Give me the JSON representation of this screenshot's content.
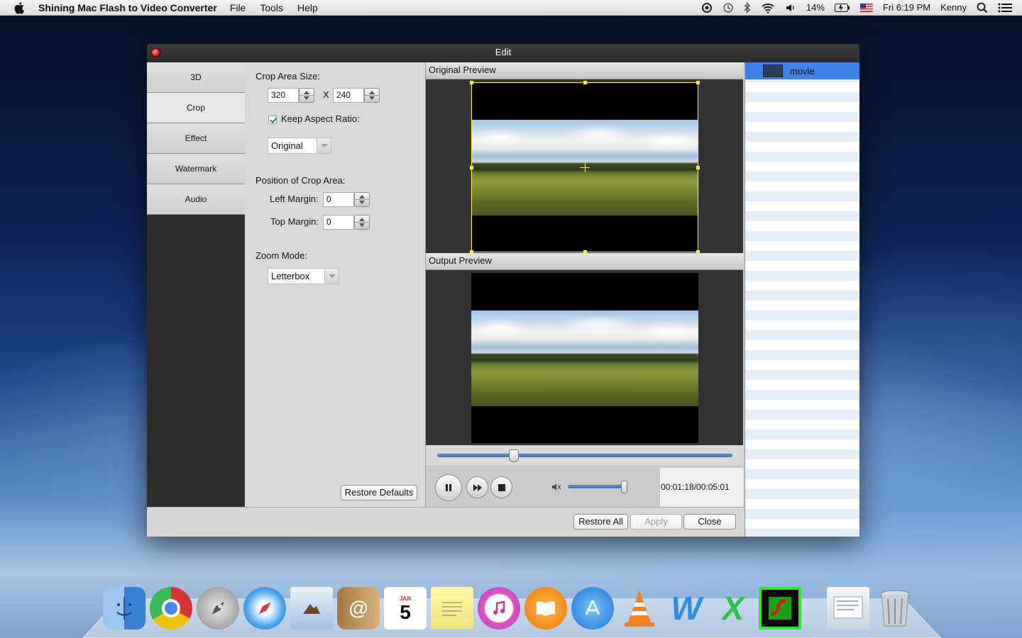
{
  "menubar": {
    "app_name": "Shining Mac Flash to Video Converter",
    "menus": [
      "File",
      "Tools",
      "Help"
    ],
    "battery": "14%",
    "datetime": "Fri 6:19 PM",
    "user": "Kenny"
  },
  "window": {
    "title": "Edit",
    "tabs": [
      {
        "label": "3D",
        "active": false
      },
      {
        "label": "Crop",
        "active": true
      },
      {
        "label": "Effect",
        "active": false
      },
      {
        "label": "Watermark",
        "active": false
      },
      {
        "label": "Audio",
        "active": false
      }
    ],
    "crop": {
      "size_label": "Crop Area Size:",
      "width": "320",
      "x_sep": "X",
      "height": "240",
      "keep_aspect_label": "Keep Aspect Ratio:",
      "keep_aspect_checked": true,
      "aspect_value": "Original",
      "position_label": "Position of Crop Area:",
      "left_margin_label": "Left Margin:",
      "left_margin": "0",
      "top_margin_label": "Top Margin:",
      "top_margin": "0",
      "zoom_label": "Zoom Mode:",
      "zoom_value": "Letterbox",
      "restore_defaults": "Restore Defaults"
    },
    "preview": {
      "original_label": "Original Preview",
      "output_label": "Output Preview",
      "seek_fraction": 0.26,
      "volume_fraction": 1.0,
      "time": "00:01:18/00:05:01"
    },
    "files": [
      {
        "name": "movie",
        "selected": true
      }
    ],
    "buttons": {
      "restore_all": "Restore All",
      "apply": "Apply",
      "close": "Close"
    }
  },
  "dock": {
    "apps": [
      "Finder",
      "Chrome",
      "Launchpad",
      "Safari",
      "Mail",
      "Contacts",
      "Calendar",
      "Notes",
      "iTunes",
      "iBooks",
      "App Store",
      "VLC",
      "Word",
      "Excel",
      "Flash to Video Converter",
      "Preview",
      "Trash"
    ],
    "calendar_month": "JAN",
    "calendar_day": "5"
  },
  "colors": {
    "accent": "#3c82e6",
    "crop_frame": "#ffff33"
  }
}
